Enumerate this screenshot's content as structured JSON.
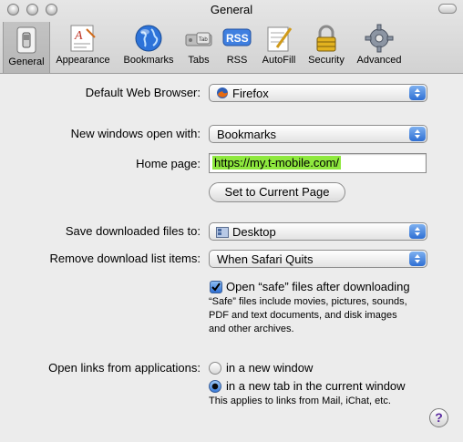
{
  "window": {
    "title": "General"
  },
  "toolbar": {
    "items": [
      {
        "label": "General",
        "icon": "switch-icon"
      },
      {
        "label": "Appearance",
        "icon": "appearance-icon"
      },
      {
        "label": "Bookmarks",
        "icon": "globe-icon"
      },
      {
        "label": "Tabs",
        "icon": "tabs-icon"
      },
      {
        "label": "RSS",
        "icon": "rss-icon"
      },
      {
        "label": "AutoFill",
        "icon": "autofill-icon"
      },
      {
        "label": "Security",
        "icon": "lock-icon"
      },
      {
        "label": "Advanced",
        "icon": "gear-icon"
      }
    ],
    "selected": "General"
  },
  "general": {
    "default_browser": {
      "label": "Default Web Browser:",
      "value": "Firefox"
    },
    "new_windows": {
      "label": "New windows open with:",
      "value": "Bookmarks"
    },
    "home_page": {
      "label": "Home page:",
      "value": "https://my.t-mobile.com/"
    },
    "set_current_label": "Set to Current Page",
    "save_downloads": {
      "label": "Save downloaded files to:",
      "value": "Desktop"
    },
    "remove_downloads": {
      "label": "Remove download list items:",
      "value": "When Safari Quits"
    },
    "open_safe": {
      "label": "Open “safe” files after downloading",
      "checked": true,
      "note_1": "“Safe” files include movies, pictures, sounds,",
      "note_2": "PDF and text documents, and disk images",
      "note_3": "and other archives."
    },
    "open_links": {
      "label": "Open links from applications:",
      "option_1": "in a new window",
      "option_2": "in a new tab in the current window",
      "selected": "option_2",
      "note": "This applies to links from Mail, iChat, etc."
    },
    "help_label": "?"
  }
}
